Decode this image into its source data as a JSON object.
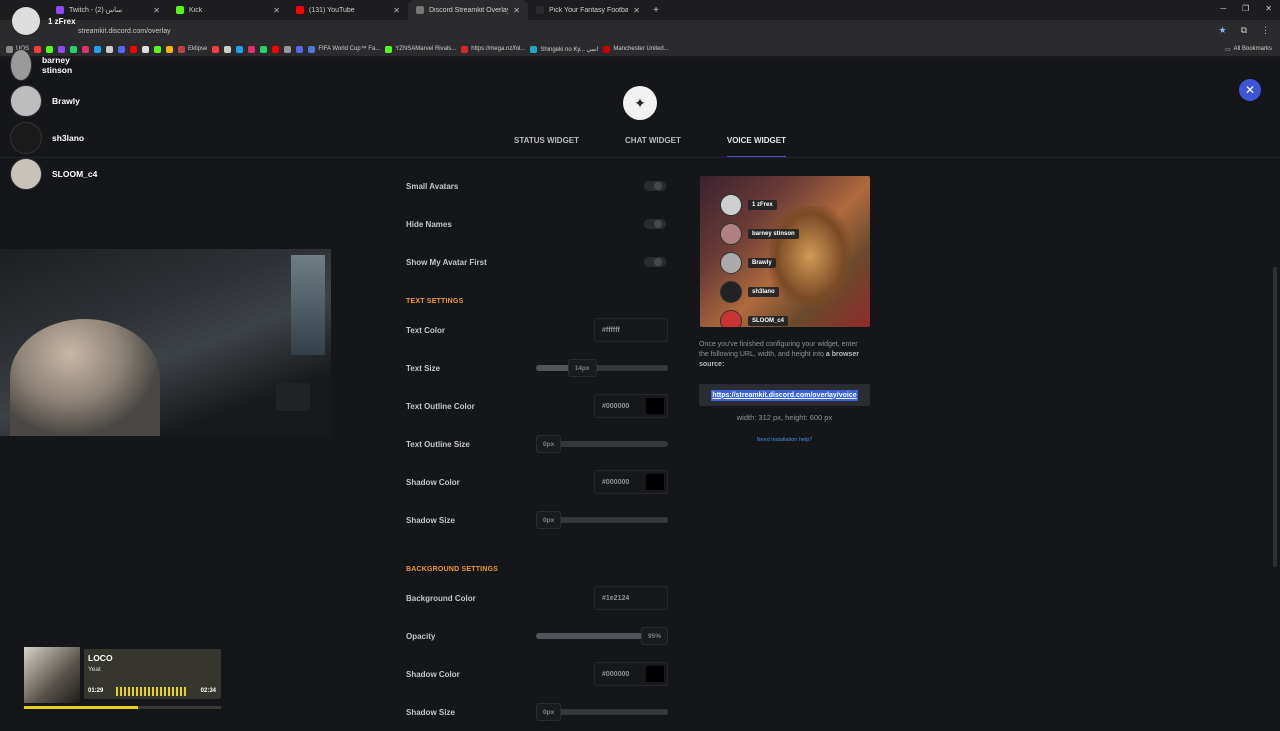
{
  "browser": {
    "tabs": [
      {
        "label": "Twitch - ساس (2)",
        "color": "#9146ff",
        "active": false
      },
      {
        "label": "Kick",
        "color": "#53fc18",
        "active": false
      },
      {
        "label": "(131) YouTube",
        "color": "#ff0000",
        "active": false
      },
      {
        "label": "Discord Streamkit Overlay",
        "color": "#777777",
        "active": true
      },
      {
        "label": "Pick Your Fantasy Football Team",
        "color": "#2b2b2e",
        "active": false
      }
    ],
    "url": "streamkit.discord.com/overlay",
    "bookmarks": [
      "UOS",
      "Eklipse",
      "FIFA World Cup™ Fa...",
      "YZNSAMarvel Rivals...",
      "https://mega.nz/fol...",
      "Shingeki no Ky... انمي",
      "Manchester United...",
      "All Bookmarks"
    ]
  },
  "voice_overlay": {
    "users": [
      {
        "name": "barney stinson"
      },
      {
        "name": "Brawly"
      },
      {
        "name": "sh3lano"
      },
      {
        "name": "SLOOM_c4"
      }
    ],
    "top_label": "1 zFrex"
  },
  "nav": {
    "tabs": [
      "STATUS WIDGET",
      "CHAT WIDGET",
      "VOICE WIDGET"
    ],
    "selected": "VOICE WIDGET"
  },
  "settings": {
    "small_avatars": "Small Avatars",
    "hide_names": "Hide Names",
    "show_avatar_first": "Show My Avatar First",
    "text_settings": "TEXT SETTINGS",
    "text_color": {
      "label": "Text Color",
      "value": "#ffffff"
    },
    "text_size": {
      "label": "Text Size",
      "value": "14px",
      "level": 0.35
    },
    "text_outline_color": {
      "label": "Text Outline Color",
      "value": "#000000"
    },
    "text_outline_size": {
      "label": "Text Outline Size",
      "value": "0px",
      "level": 0
    },
    "shadow_color": {
      "label": "Shadow Color",
      "value": "#000000"
    },
    "shadow_size": {
      "label": "Shadow Size",
      "value": "0px",
      "level": 0
    },
    "background_settings": "BACKGROUND SETTINGS",
    "background_color": {
      "label": "Background Color",
      "value": "#1e2124"
    },
    "opacity": {
      "label": "Opacity",
      "value": "95%",
      "level": 0.95
    },
    "bg_shadow_color": {
      "label": "Shadow Color",
      "value": "#000000"
    },
    "bg_shadow_size": {
      "label": "Shadow Size",
      "value": "0px",
      "level": 0
    }
  },
  "preview": {
    "users": [
      "1 zFrex",
      "barney stinson",
      "Brawly",
      "sh3lano",
      "SLOOM_c4"
    ]
  },
  "output": {
    "help_text": "Once you've finished configuring your widget, enter the following URL, width, and height into",
    "help_bold": "a browser source:",
    "url": "https://streamkit.discord.com/overlay/voice",
    "dims": "width: 312 px, height: 600 px",
    "need_help": "Need installation help?"
  },
  "player": {
    "title": "LOCO",
    "artist": "Yeat",
    "elapsed": "01:29",
    "duration": "02:34",
    "progress": 0.58
  }
}
